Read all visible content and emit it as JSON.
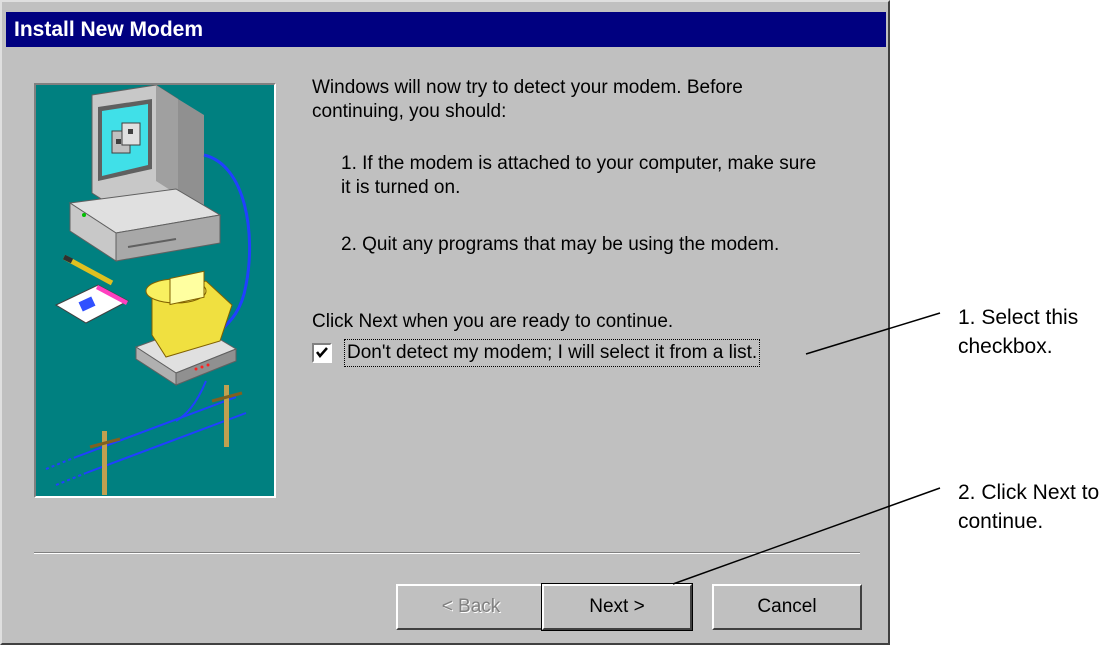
{
  "dialog": {
    "title": "Install New Modem",
    "intro": "Windows will now try to detect your modem.  Before continuing, you should:",
    "steps": [
      "1.  If the modem is attached to your computer, make sure it is turned on.",
      "2.  Quit any programs that may be using the modem."
    ],
    "ready_text": "Click Next when you are ready to continue.",
    "checkbox": {
      "label": "Don't detect my modem; I will select it from a list.",
      "checked": true
    },
    "buttons": {
      "back": "< Back",
      "next": "Next >",
      "cancel": "Cancel"
    }
  },
  "annotations": [
    "1. Select this checkbox.",
    "2. Click Next to continue."
  ],
  "colors": {
    "titlebar": "#000080",
    "dialog_bg": "#c0c0c0",
    "illustration_bg": "#008080"
  }
}
